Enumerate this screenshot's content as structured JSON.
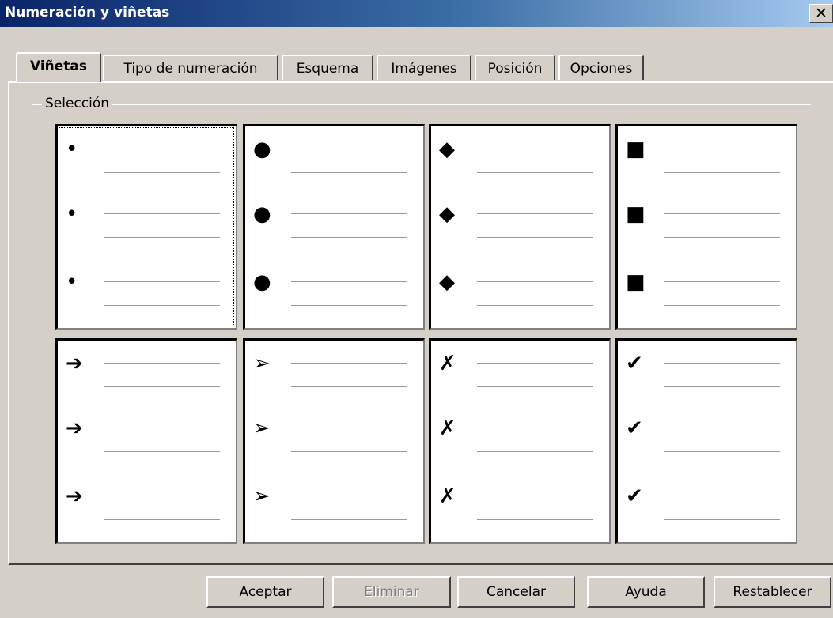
{
  "window": {
    "title": "Numeración y viñetas",
    "close_label": "✕"
  },
  "tabs": [
    "Viñetas",
    "Tipo de numeración",
    "Esquema",
    "Imágenes",
    "Posición",
    "Opciones"
  ],
  "active_tab": "Viñetas",
  "selection": {
    "label": "Selección",
    "selected_index": 0,
    "styles": [
      {
        "icon": "small-dot-icon",
        "glyph": "•"
      },
      {
        "icon": "large-dot-icon",
        "glyph": "●"
      },
      {
        "icon": "diamond-icon",
        "glyph": "◆"
      },
      {
        "icon": "square-icon",
        "glyph": "■"
      },
      {
        "icon": "arrow-icon",
        "glyph": "➔"
      },
      {
        "icon": "arrowhead-icon",
        "glyph": "➢"
      },
      {
        "icon": "cross-icon",
        "glyph": "✗"
      },
      {
        "icon": "checkmark-icon",
        "glyph": "✔"
      }
    ]
  },
  "buttons": {
    "ok": "Aceptar",
    "delete": "Eliminar",
    "cancel": "Cancelar",
    "help": "Ayuda",
    "reset": "Restablecer"
  }
}
